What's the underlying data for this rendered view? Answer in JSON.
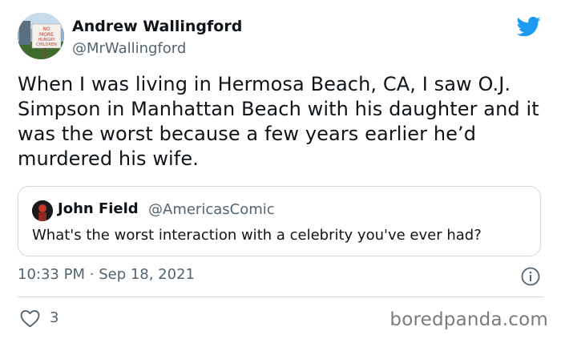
{
  "author": {
    "name": "Andrew Wallingford",
    "handle": "@MrWallingford",
    "avatar_sign_text": "NO MORE HUNGRY CHILDREN"
  },
  "tweet": {
    "text": "When I was living in Hermosa Beach, CA, I saw O.J. Simpson in Manhattan Beach with his daughter and it was the worst because a few years earlier he’d murdered his wife."
  },
  "quoted_tweet": {
    "name": "John Field",
    "handle": "@AmericasComic",
    "text": "What's the worst interaction with a celebrity you've ever had?"
  },
  "meta": {
    "time": "10:33 PM",
    "separator": "·",
    "date": "Sep 18, 2021"
  },
  "engagement": {
    "likes": "3"
  },
  "watermark": "boredpanda.com",
  "icons": {
    "brand": "twitter-bird-icon",
    "info": "info-icon",
    "like": "heart-icon"
  },
  "colors": {
    "twitter_blue": "#1d9bf0",
    "text_primary": "#0f1419",
    "text_secondary": "#536471",
    "border": "#cfd9de"
  }
}
